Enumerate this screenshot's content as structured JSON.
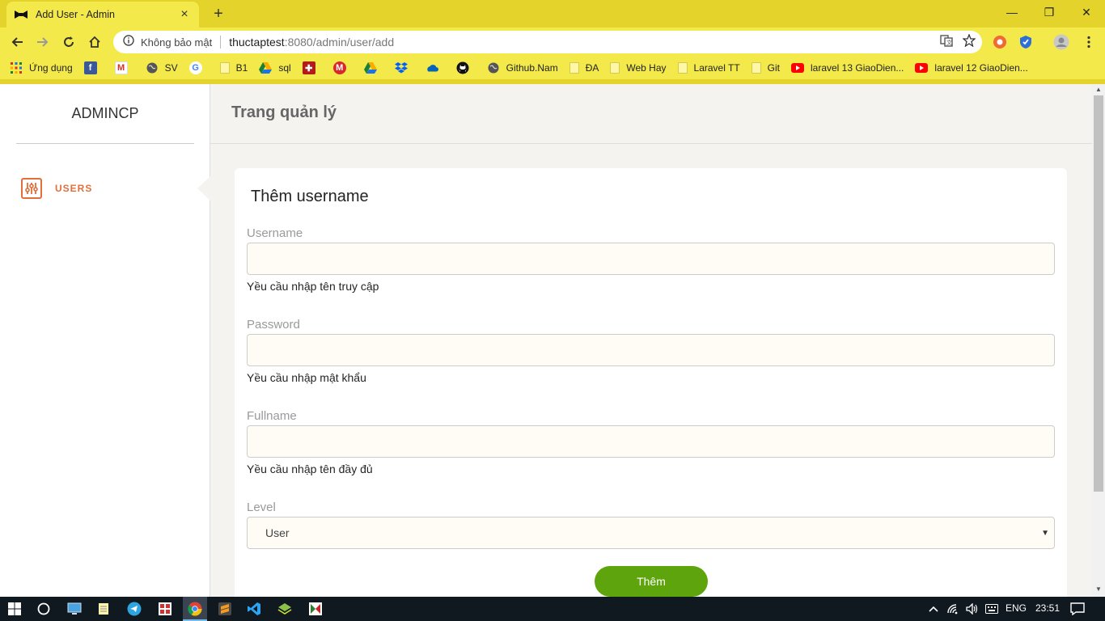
{
  "browser": {
    "tab_title": "Add User - Admin",
    "tab_close": "×",
    "new_tab": "+",
    "window_controls": {
      "minimize": "—",
      "maximize": "❐",
      "close": "✕"
    },
    "omnibox": {
      "security_text": "Không bảo mật",
      "host": "thuctaptest",
      "path": ":8080/admin/user/add"
    },
    "bookmarks": [
      {
        "label": "Ứng dụng",
        "icon": "apps-grid-icon"
      },
      {
        "label": "",
        "icon": "facebook-icon"
      },
      {
        "label": "",
        "icon": "gmail-icon"
      },
      {
        "label": "SV",
        "icon": "globe-icon"
      },
      {
        "label": "",
        "icon": "google-icon"
      },
      {
        "label": "B1",
        "icon": "folder-icon"
      },
      {
        "label": "sql",
        "icon": "google-drive-icon"
      },
      {
        "label": "",
        "icon": "shield-crest-icon"
      },
      {
        "label": "",
        "icon": "mega-icon"
      },
      {
        "label": "",
        "icon": "google-drive-icon"
      },
      {
        "label": "",
        "icon": "dropbox-icon"
      },
      {
        "label": "",
        "icon": "onedrive-icon"
      },
      {
        "label": "",
        "icon": "github-icon"
      },
      {
        "label": "Github.Nam",
        "icon": "globe-icon"
      },
      {
        "label": "ĐA",
        "icon": "folder-icon"
      },
      {
        "label": "Web Hay",
        "icon": "folder-icon"
      },
      {
        "label": "Laravel TT",
        "icon": "folder-icon"
      },
      {
        "label": "Git",
        "icon": "folder-icon"
      },
      {
        "label": "laravel 13 GiaoDien...",
        "icon": "youtube-icon"
      },
      {
        "label": "laravel 12 GiaoDien...",
        "icon": "youtube-icon"
      }
    ]
  },
  "sidebar": {
    "brand": "ADMINCP",
    "items": [
      {
        "label": "USERS",
        "icon": "sliders-icon"
      }
    ]
  },
  "header": {
    "title": "Trang quản lý"
  },
  "form": {
    "title": "Thêm username",
    "fields": [
      {
        "label": "Username",
        "value": "",
        "help": "Yều cầu nhập tên truy cập"
      },
      {
        "label": "Password",
        "value": "",
        "help": "Yều cầu nhập mật khẩu"
      },
      {
        "label": "Fullname",
        "value": "",
        "help": "Yều cầu nhập tên đầy đủ"
      }
    ],
    "level": {
      "label": "Level",
      "selected": "User"
    },
    "submit_label": "Thêm"
  },
  "taskbar": {
    "language": "ENG",
    "time": "23:51"
  },
  "colors": {
    "chrome": "#e3d32a",
    "accent_orange": "#e06f3a",
    "submit_green": "#5ea40c",
    "input_bg": "#fffcf5"
  }
}
